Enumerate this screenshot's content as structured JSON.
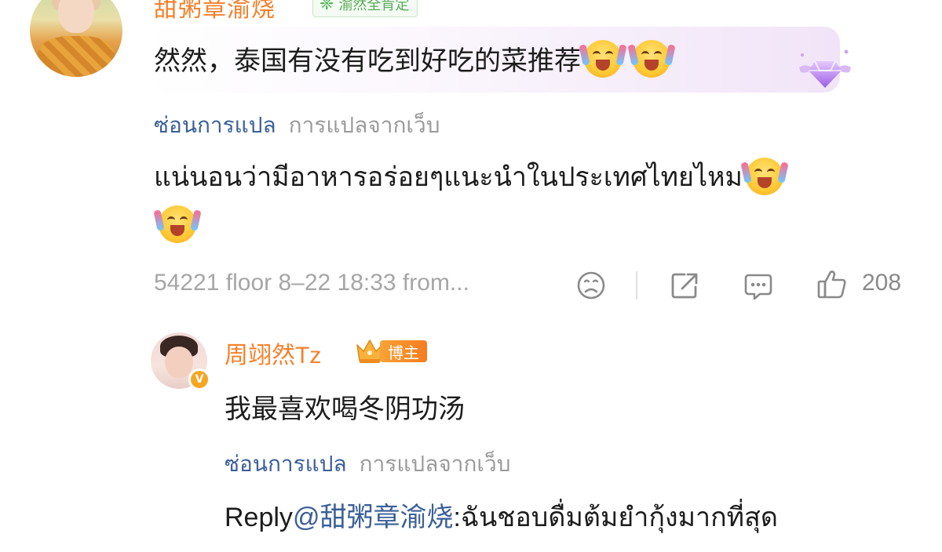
{
  "main_comment": {
    "user_name": "甜粥章渝烧",
    "fan_badge": "渝然全肯定",
    "text": "然然，泰国有没有吃到好吃的菜推荐",
    "emojis": [
      "laugh-cry-emoji",
      "laugh-cry-emoji"
    ],
    "hide_translation": "ซ่อนการแปล",
    "translation_source": "การแปลจากเว็บ",
    "translated_text": "แน่นอนว่ามีอาหารอร่อยๆแนะนำในประเทศไทยไหม",
    "meta": "54221 floor 8–22 18:33 from...",
    "like_count": "208"
  },
  "reply": {
    "user_name": "周翊然Tz",
    "blogger_badge": "博主",
    "text": "我最喜欢喝冬阴功汤",
    "hide_translation": "ซ่อนการแปล",
    "translation_source": "การแปลจากเว็บ",
    "reply_prefix": "Reply",
    "mention": "@甜粥章渝烧",
    "translated_text": ":ฉันชอบดื่มต้มยำกุ้งมากที่สุด"
  },
  "colors": {
    "username": "#f5802a",
    "link": "#3a5f98",
    "meta_gray": "#a6a6a6",
    "fan_badge_green": "#5aa95a"
  },
  "icons": {
    "dislike": "sad-face-icon",
    "share": "share-icon",
    "comment": "comment-icon",
    "like": "thumbs-up-icon",
    "verified": "verified-v-icon",
    "crown": "crown-icon",
    "diamond": "diamond-wings-icon"
  }
}
